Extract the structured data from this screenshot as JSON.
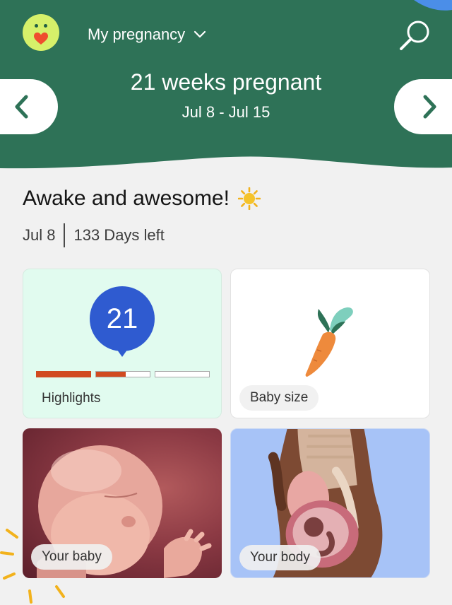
{
  "header": {
    "app_title": "My pregnancy",
    "week_title": "21 weeks pregnant",
    "week_range": "Jul 8 - Jul 15"
  },
  "greeting": {
    "text": "Awake and awesome!",
    "emoji_icon": "sun-icon",
    "date": "Jul 8",
    "days_left": "133 Days left"
  },
  "cards": {
    "highlights": {
      "label": "Highlights",
      "week_number": "21",
      "progress": [
        1.0,
        0.55,
        0.0,
        0.0
      ]
    },
    "baby_size": {
      "label": "Baby size",
      "icon": "carrot-icon"
    },
    "your_baby": {
      "label": "Your baby"
    },
    "your_body": {
      "label": "Your body"
    }
  },
  "colors": {
    "header_green": "#2e7257",
    "accent_orange": "#d14a20",
    "badge_blue": "#2f5bd0",
    "logo_lime": "#d6f06a"
  }
}
